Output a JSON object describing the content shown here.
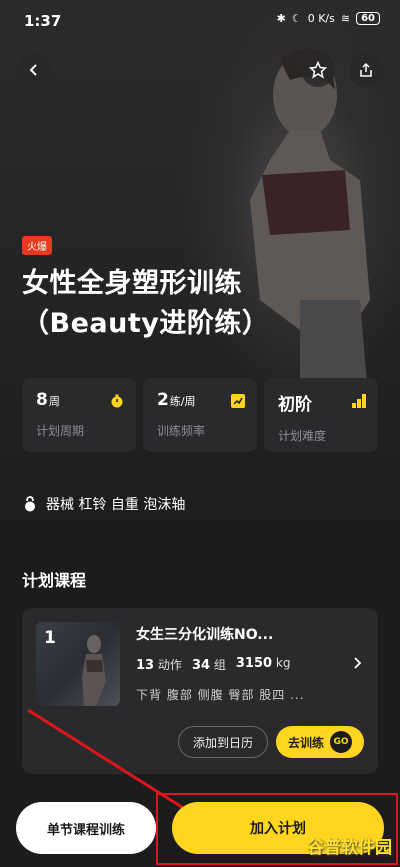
{
  "status": {
    "time": "1:37",
    "net": "0 K/s",
    "battery": "60"
  },
  "hero": {
    "badge": "火爆",
    "title_line1": "女性全身塑形训练",
    "title_line2": "（Beauty进阶练）"
  },
  "stats": [
    {
      "value": "8",
      "unit": "周",
      "label": "计划周期"
    },
    {
      "value": "2",
      "unit": "练/周",
      "label": "训练频率"
    },
    {
      "value": "初阶",
      "unit": "",
      "label": "计划难度"
    }
  ],
  "equipment": "器械 杠铃 自重 泡沫轴",
  "section": {
    "title": "计划课程"
  },
  "course": {
    "number": "1",
    "name": "女生三分化训练NO...",
    "actions": "13",
    "actions_unit": "动作",
    "sets": "34",
    "sets_unit": "组",
    "weight": "3150",
    "weight_unit": "kg",
    "tags": "下背 腹部 侧腹 臀部 股四 ...",
    "add_calendar": "添加到日历",
    "go_train": "去训练",
    "go_badge": "GO"
  },
  "bottom": {
    "single_course": "单节课程训练",
    "join_plan": "加入计划"
  },
  "watermark": "谷普软件园",
  "colors": {
    "accent": "#ffd51f",
    "badge": "#e8391e",
    "annotation": "#e0141b"
  }
}
